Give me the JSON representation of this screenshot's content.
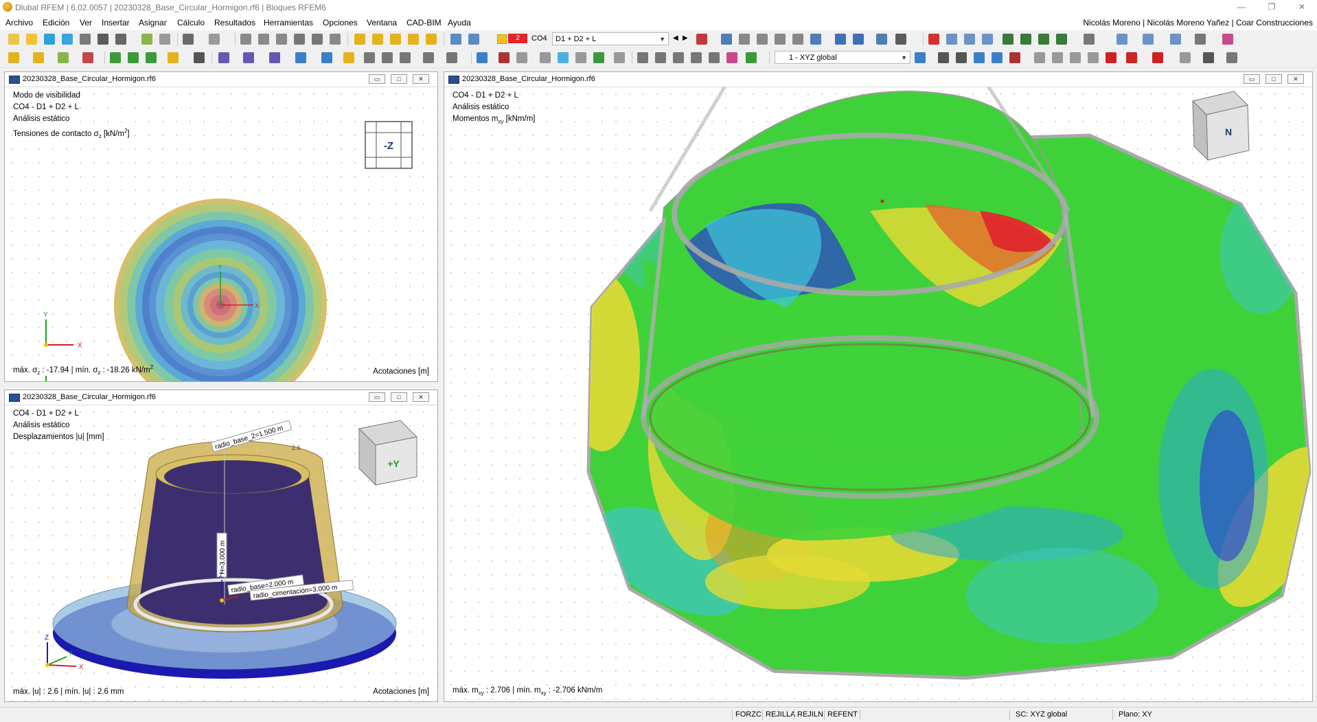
{
  "app": {
    "title": "Dlubal RFEM | 6.02.0057 | 20230328_Base_Circular_Hormigon.rf6 | Bloques RFEM6",
    "user": "Nicolás Moreno | Nicolás Moreno Yañez | Coar Construcciones"
  },
  "menu": [
    "Archivo",
    "Edición",
    "Ver",
    "Insertar",
    "Asignar",
    "Cálculo",
    "Resultados",
    "Herramientas",
    "Opciones",
    "Ventana",
    "CAD-BIM",
    "Ayuda"
  ],
  "toolbar": {
    "loadcase_number": "2",
    "loadcase_name": "CO4",
    "loadcase_combo": "D1 + D2 + L",
    "coord_system": "1 - XYZ global"
  },
  "panes": {
    "top_left": {
      "title": "20230328_Base_Circular_Hormigon.rf6",
      "lines": [
        "Modo de visibilidad",
        "CO4 - D1 + D2 + L",
        "Análisis estático"
      ],
      "result_label": "Tensiones de contacto σ",
      "result_sub": "z",
      "result_unit": " [kN/m",
      "result_unit_sup": "2",
      "result_close": "]",
      "view_cube": "-Z",
      "footer_max_label": "máx. σ",
      "footer_sub": "z",
      "footer_max_value": " : -17.94 | mín. σ",
      "footer_sub2": "z",
      "footer_min_value": " : -18.26 kN/m",
      "footer_sup": "2",
      "footer_right": "Acotaciones [m]",
      "axes": {
        "x": "X",
        "y": "Y"
      }
    },
    "bottom_left": {
      "title": "20230328_Base_Circular_Hormigon.rf6",
      "lines": [
        "CO4 - D1 + D2 + L",
        "Análisis estático",
        "Desplazamientos |u| [mm]"
      ],
      "view_cube": "+Y",
      "dims": {
        "radio_base_2": "radio_base_2=1.500 m",
        "height": "H=3.000 m",
        "radio_base": "radio_base=2.000 m",
        "radio_cimentacion": "radio_cimentación=3.000 m",
        "small": "2.6"
      },
      "footer_left": "máx. |u| : 2.6 | mín. |u| : 2.6 mm",
      "footer_right": "Acotaciones [m]",
      "axes": {
        "x": "X",
        "y": "Y",
        "z": "Z"
      }
    },
    "right": {
      "title": "20230328_Base_Circular_Hormigon.rf6",
      "lines": [
        "CO4 - D1 + D2 + L",
        "Análisis estático"
      ],
      "result_label": "Momentos m",
      "result_sub": "xy",
      "result_unit": " [kNm/m]",
      "view_cube": "N",
      "footer_a": "máx. m",
      "footer_sub": "xy",
      "footer_b": " : 2.706 | mín. m",
      "footer_sub2": "xy",
      "footer_c": " : -2.706 kNm/m"
    }
  },
  "status": {
    "toggles": [
      "FORZC",
      "REJILLA",
      "REJILN",
      "REFENT"
    ],
    "cs": "SC: XYZ global",
    "plane": "Plano: XY"
  },
  "colors": {
    "pane_border": "#a9a9a9",
    "plate_green": "#3fd13a",
    "moment_yellow": "#e2d934",
    "moment_red": "#e0222e",
    "moment_blue": "#2a3bd6",
    "moment_cyan": "#3ec8d8",
    "disp_purple": "#3d2f6f",
    "disp_gold": "#c9a840",
    "disp_blue": "#1a1ab0"
  }
}
